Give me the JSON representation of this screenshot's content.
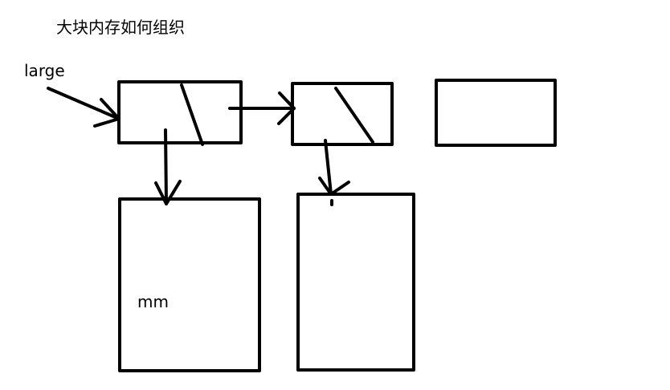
{
  "title": "大块内存如何组织",
  "labels": {
    "head": "large",
    "block": "mm"
  },
  "colors": {
    "stroke": "#000000",
    "background": "#ffffff"
  }
}
